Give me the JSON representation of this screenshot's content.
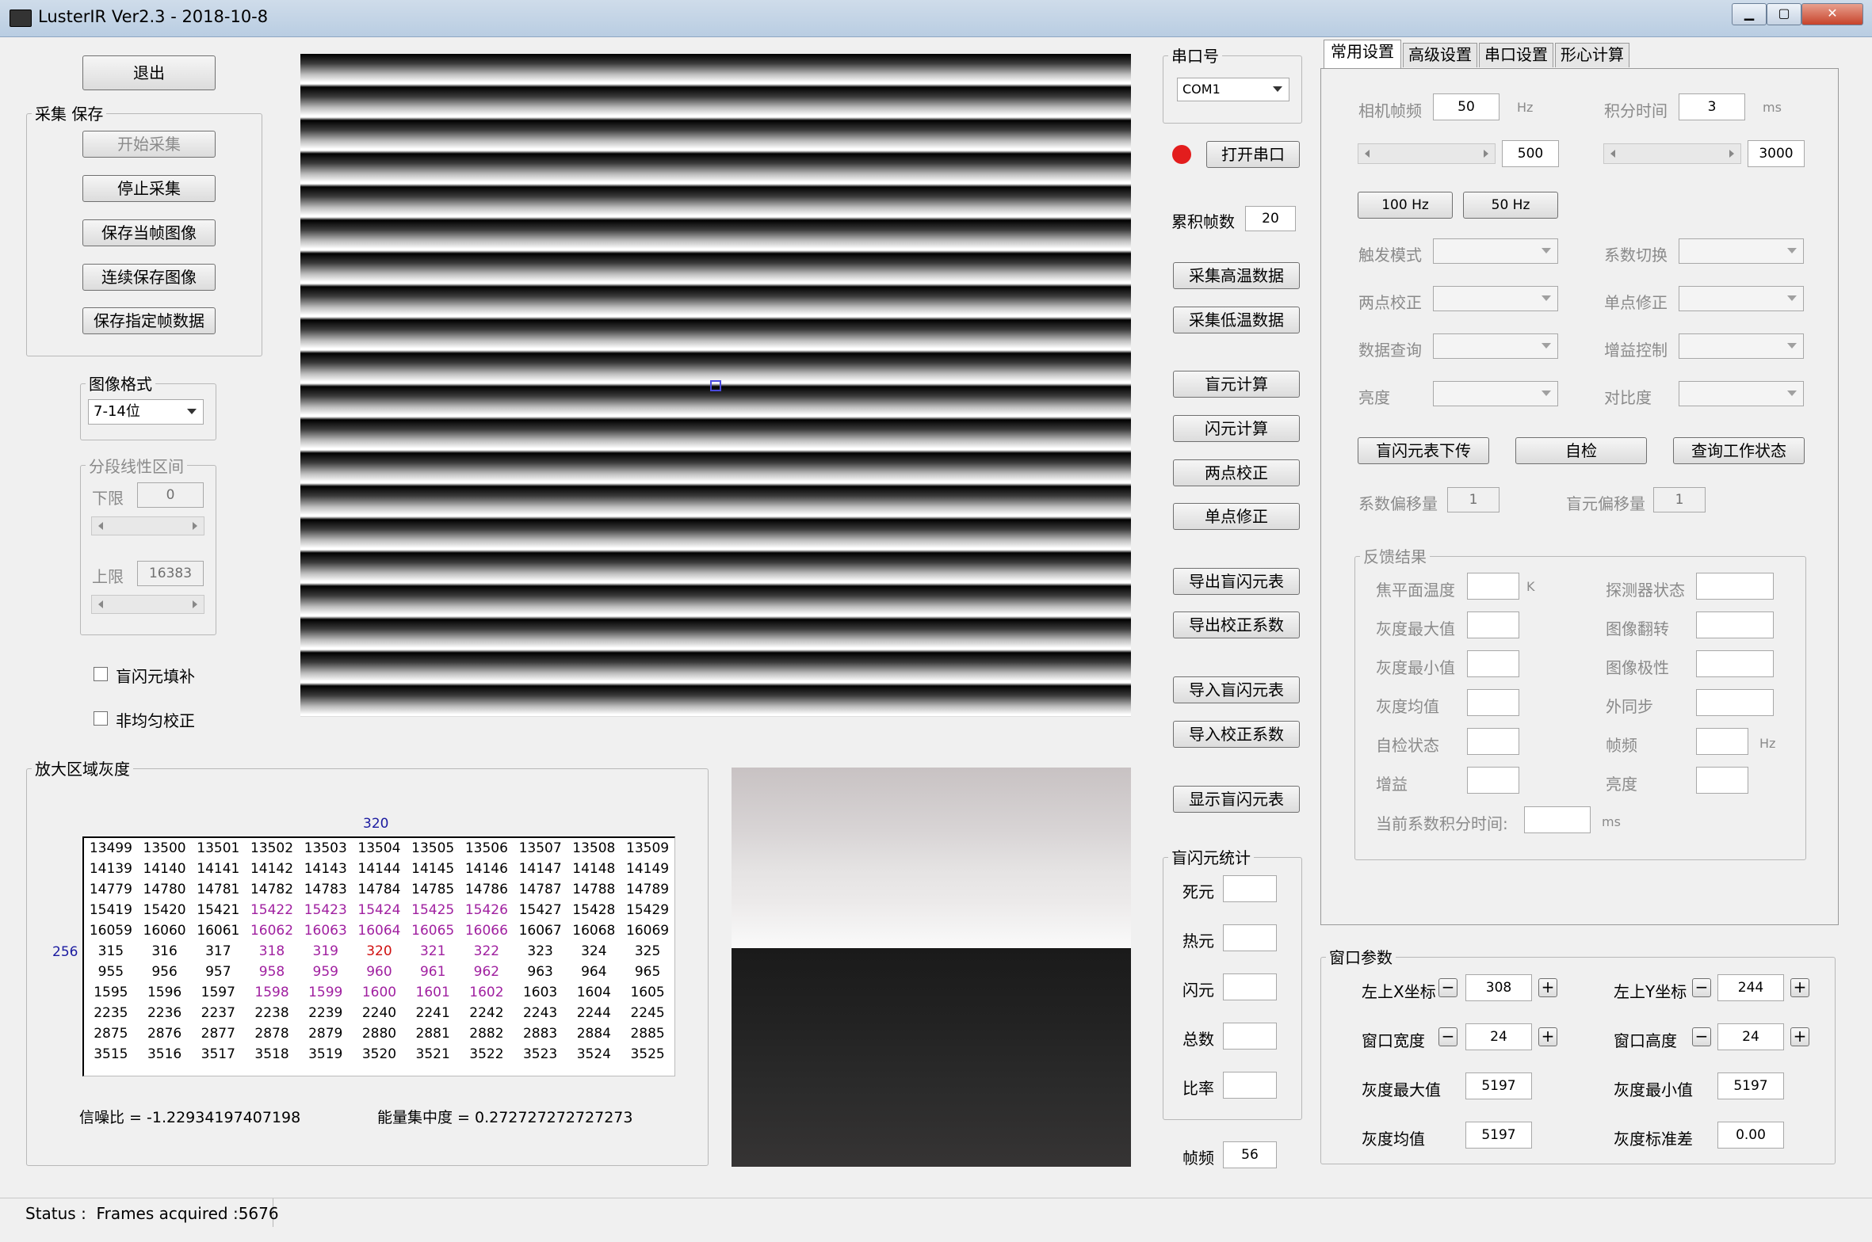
{
  "window": {
    "title": "LusterIR Ver2.3 - 2018-10-8",
    "min": "▁",
    "max": "▢",
    "close": "✕"
  },
  "left": {
    "exit": "退出",
    "capture_group": "采集 保存",
    "start_capture": "开始采集",
    "stop_capture": "停止采集",
    "save_frame": "保存当帧图像",
    "continuous_save": "连续保存图像",
    "save_specified": "保存指定帧数据",
    "format_group": "图像格式",
    "format_value": "7-14位",
    "linear_group": "分段线性区间",
    "lower_label": "下限",
    "lower_value": "0",
    "upper_label": "上限",
    "upper_value": "16383",
    "blind_fill": "盲闪元填补",
    "nonuniform": "非均匀校正"
  },
  "zoom": {
    "group": "放大区域灰度",
    "col_label": "320",
    "row_label": "256",
    "rows": [
      [
        "13499",
        "13500",
        "13501",
        "13502",
        "13503",
        "13504",
        "13505",
        "13506",
        "13507",
        "13508",
        "13509"
      ],
      [
        "14139",
        "14140",
        "14141",
        "14142",
        "14143",
        "14144",
        "14145",
        "14146",
        "14147",
        "14148",
        "14149"
      ],
      [
        "14779",
        "14780",
        "14781",
        "14782",
        "14783",
        "14784",
        "14785",
        "14786",
        "14787",
        "14788",
        "14789"
      ],
      [
        "15419",
        "15420",
        "15421",
        "15422",
        "15423",
        "15424",
        "15425",
        "15426",
        "15427",
        "15428",
        "15429"
      ],
      [
        "16059",
        "16060",
        "16061",
        "16062",
        "16063",
        "16064",
        "16065",
        "16066",
        "16067",
        "16068",
        "16069"
      ],
      [
        "315",
        "316",
        "317",
        "318",
        "319",
        "320",
        "321",
        "322",
        "323",
        "324",
        "325"
      ],
      [
        "955",
        "956",
        "957",
        "958",
        "959",
        "960",
        "961",
        "962",
        "963",
        "964",
        "965"
      ],
      [
        "1595",
        "1596",
        "1597",
        "1598",
        "1599",
        "1600",
        "1601",
        "1602",
        "1603",
        "1604",
        "1605"
      ],
      [
        "2235",
        "2236",
        "2237",
        "2238",
        "2239",
        "2240",
        "2241",
        "2242",
        "2243",
        "2244",
        "2245"
      ],
      [
        "2875",
        "2876",
        "2877",
        "2878",
        "2879",
        "2880",
        "2881",
        "2882",
        "2883",
        "2884",
        "2885"
      ],
      [
        "3515",
        "3516",
        "3517",
        "3518",
        "3519",
        "3520",
        "3521",
        "3522",
        "3523",
        "3524",
        "3525"
      ]
    ],
    "snr_label": "信噪比 = -1.22934197407198",
    "energy_label": "能量集中度 = 0.272727272727273"
  },
  "middle": {
    "port_group": "串口号",
    "port_value": "COM1",
    "open_port": "打开串口",
    "accum_label": "累积帧数",
    "accum_value": "20",
    "capture_high": "采集高温数据",
    "capture_low": "采集低温数据",
    "blind_calc": "盲元计算",
    "flash_calc": "闪元计算",
    "two_point": "两点校正",
    "single_point": "单点修正",
    "export_blind": "导出盲闪元表",
    "export_coef": "导出校正系数",
    "import_blind": "导入盲闪元表",
    "import_coef": "导入校正系数",
    "show_blind": "显示盲闪元表",
    "stats_group": "盲闪元统计",
    "dead": "死元",
    "hot": "热元",
    "flash": "闪元",
    "total": "总数",
    "ratio": "比率",
    "fps_label": "帧频",
    "fps_value": "56"
  },
  "tabs": [
    "常用设置",
    "高级设置",
    "串口设置",
    "形心计算"
  ],
  "settings": {
    "frame_rate_label": "相机帧频",
    "frame_rate_value": "50",
    "frame_rate_unit": "Hz",
    "integ_label": "积分时间",
    "integ_value": "3",
    "integ_unit": "ms",
    "slider1_value": "500",
    "slider2_value": "3000",
    "hz100": "100 Hz",
    "hz50": "50 Hz",
    "trigger_mode": "触发模式",
    "coef_switch": "系数切换",
    "two_point_corr": "两点校正",
    "single_point_corr": "单点修正",
    "data_query": "数据查询",
    "gain_ctrl": "增益控制",
    "brightness": "亮度",
    "contrast": "对比度",
    "blind_upload": "盲闪元表下传",
    "self_check": "自检",
    "query_status": "查询工作状态",
    "coef_offset_label": "系数偏移量",
    "coef_offset_value": "1",
    "blind_offset_label": "盲元偏移量",
    "blind_offset_value": "1",
    "feedback_group": "反馈结果",
    "fpa_temp": "焦平面温度",
    "fpa_unit": "K",
    "detector_status": "探测器状态",
    "gray_max": "灰度最大值",
    "image_flip": "图像翻转",
    "gray_min": "灰度最小值",
    "image_polarity": "图像极性",
    "gray_mean": "灰度均值",
    "ext_sync": "外同步",
    "self_check_status": "自检状态",
    "frame_freq": "帧频",
    "frame_freq_unit": "Hz",
    "gain": "增益",
    "brightness2": "亮度",
    "cur_integ": "当前系数积分时间:",
    "cur_integ_unit": "ms"
  },
  "window_params": {
    "group": "窗口参数",
    "x_label": "左上X坐标",
    "x_value": "308",
    "y_label": "左上Y坐标",
    "y_value": "244",
    "w_label": "窗口宽度",
    "w_value": "24",
    "h_label": "窗口高度",
    "h_value": "24",
    "max_label": "灰度最大值",
    "max_value": "5197",
    "min_label": "灰度最小值",
    "min_value": "5197",
    "mean_label": "灰度均值",
    "mean_value": "5197",
    "std_label": "灰度标准差",
    "std_value": "0.00",
    "minus": "−",
    "plus": "+"
  },
  "status": "Status :  Frames acquired :5676"
}
